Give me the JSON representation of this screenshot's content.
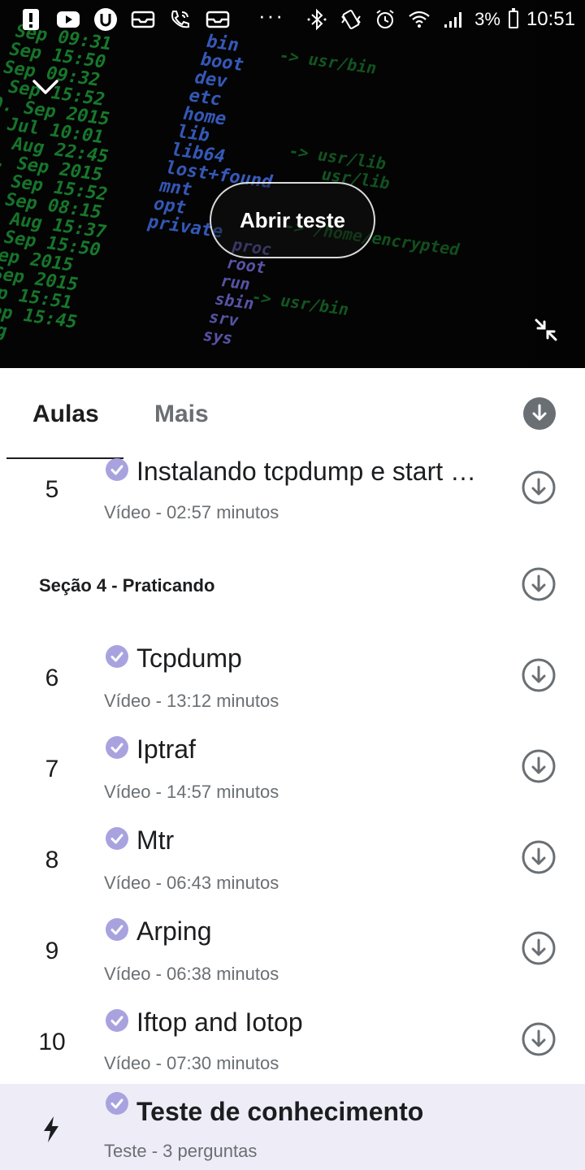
{
  "status_bar": {
    "battery_percent": "3%",
    "time": "10:51",
    "more_indicator": "···",
    "left_icons": [
      "alert-icon",
      "youtube-icon",
      "app-u-icon",
      "mail-icon",
      "wifi-call-icon",
      "mail-icon"
    ],
    "right_icons": [
      "bluetooth-icon",
      "vibrate-icon",
      "alarm-icon",
      "wifi-icon",
      "signal-icon",
      "battery-icon"
    ]
  },
  "player": {
    "open_test_label": "Abrir teste"
  },
  "tabs": [
    {
      "label": "Aulas"
    },
    {
      "label": "Mais"
    }
  ],
  "lessons_top": [
    {
      "number": "5",
      "title": "Instalando tcpdump e start …",
      "meta": "Vídeo - 02:57 minutos"
    }
  ],
  "section": {
    "title": "Seção 4 - Praticando"
  },
  "lessons": [
    {
      "number": "6",
      "title": "Tcpdump",
      "meta": "Vídeo - 13:12 minutos"
    },
    {
      "number": "7",
      "title": "Iptraf",
      "meta": "Vídeo - 14:57 minutos"
    },
    {
      "number": "8",
      "title": "Mtr",
      "meta": "Vídeo - 06:43 minutos"
    },
    {
      "number": "9",
      "title": "Arping",
      "meta": "Vídeo - 06:38 minutos"
    },
    {
      "number": "10",
      "title": "Iftop and Iotop",
      "meta": "Vídeo - 07:30 minutos"
    }
  ],
  "quiz": {
    "title": "Teste de conhecimento",
    "meta": "Teste - 3 perguntas"
  },
  "colors": {
    "check": "#a8a3df",
    "text_primary": "#1c1d1f",
    "text_secondary": "#6a6f73",
    "quiz_highlight": "#eeedf7",
    "icon_gray": "#6a6f73"
  }
}
